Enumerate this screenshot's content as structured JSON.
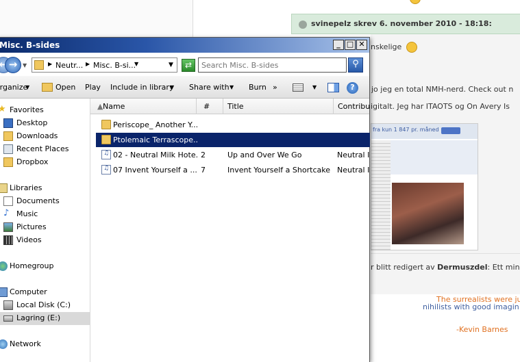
{
  "forum": {
    "post_author": "svinepelz skrev 6. november 2010 - 18:18:",
    "post_text_1": "nskelige",
    "post_text_2": "jo jeg en total NMH-nerd. Check out n",
    "post_text_3": "igitalt. Jeg har ITAOTS og On Avery Is",
    "thumb_banner": "fra kun 1 847 pr. måned",
    "edit_note_prefix": "r blitt redigert av",
    "edit_note_user": "Dermuszdel",
    "edit_note_suffix": ": Ett minut",
    "signature_line_1": "The surrealists were ju",
    "signature_line_2": "nihilists with good imagin",
    "signature_author": "-Kevin Barnes"
  },
  "window": {
    "title": "Misc. B-sides",
    "controls": {
      "minimize": "_",
      "maximize": "□",
      "close": "✕"
    }
  },
  "address": {
    "crumbs": [
      "Neutr...",
      "Misc. B-si..."
    ],
    "search_placeholder": "Search Misc. B-sides"
  },
  "toolbar": {
    "organize": "Organize",
    "open": "Open",
    "play": "Play",
    "include_in_library": "Include in library",
    "share_with": "Share with",
    "burn": "Burn",
    "more": "»"
  },
  "nav": {
    "favorites": "Favorites",
    "desktop": "Desktop",
    "downloads": "Downloads",
    "recent_places": "Recent Places",
    "dropbox": "Dropbox",
    "libraries": "Libraries",
    "documents": "Documents",
    "music": "Music",
    "pictures": "Pictures",
    "videos": "Videos",
    "homegroup": "Homegroup",
    "computer": "Computer",
    "local_disk": "Local Disk (C:)",
    "lagring": "Lagring (E:)",
    "network": "Network"
  },
  "columns": {
    "name": "Name",
    "number": "#",
    "title": "Title",
    "contributing": "Contribu"
  },
  "files": [
    {
      "name": "Periscope_ Another Y...",
      "number": "",
      "title": "",
      "artist": "",
      "type": "folder"
    },
    {
      "name": "Ptolemaic Terrascope...",
      "number": "",
      "title": "",
      "artist": "",
      "type": "folder"
    },
    {
      "name": "02 - Neutral Milk Hote...",
      "number": "2",
      "title": "Up and Over We Go",
      "artist": "Neutral I",
      "type": "audio"
    },
    {
      "name": "07 Invent Yourself a ...",
      "number": "7",
      "title": "Invent Yourself a Shortcake",
      "artist": "Neutral I",
      "type": "audio"
    }
  ],
  "colors": {
    "selection": "#0a246a",
    "title_bar": "#0b2a6b",
    "signature": "#e07020"
  }
}
